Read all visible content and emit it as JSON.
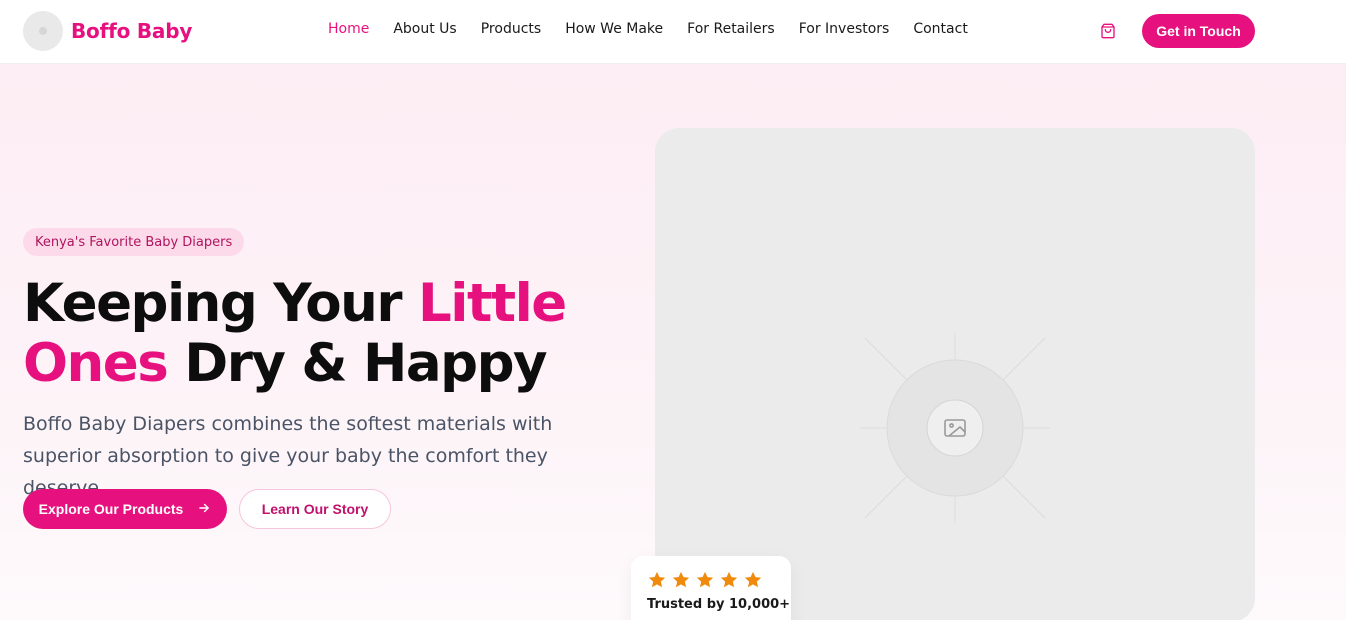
{
  "header": {
    "brand": "Boffo Baby",
    "nav": [
      {
        "label": "Home",
        "active": true
      },
      {
        "label": "About Us",
        "active": false
      },
      {
        "label": "Products",
        "active": false
      },
      {
        "label": "How We Make",
        "active": false
      },
      {
        "label": "For Retailers",
        "active": false
      },
      {
        "label": "For Investors",
        "active": false
      },
      {
        "label": "Contact",
        "active": false
      }
    ],
    "cart_icon": "shopping-bag-icon",
    "cta_label": "Get in Touch"
  },
  "hero": {
    "badge": "Kenya's Favorite Baby Diapers",
    "headline": {
      "part1": "Keeping Your ",
      "highlight1": "Little",
      "highlight2": "Ones",
      "part2": " Dry & Happy"
    },
    "description": "Boffo Baby Diapers combines the softest materials with superior absorption to give your baby the comfort they deserve.",
    "primary_button": "Explore Our Products",
    "primary_button_icon": "arrow-right-icon",
    "secondary_button": "Learn Our Story",
    "image_placeholder_icon": "image-icon",
    "trust": {
      "rating": 5,
      "rating_max": 5,
      "star_icon": "star-icon",
      "text": "Trusted by 10,000+"
    }
  },
  "colors": {
    "brand": "#e6117e",
    "badge_bg": "#fcdae9",
    "star": "#f08a0c",
    "text_dark": "#0d0d0d",
    "text_muted": "#4a5466"
  }
}
